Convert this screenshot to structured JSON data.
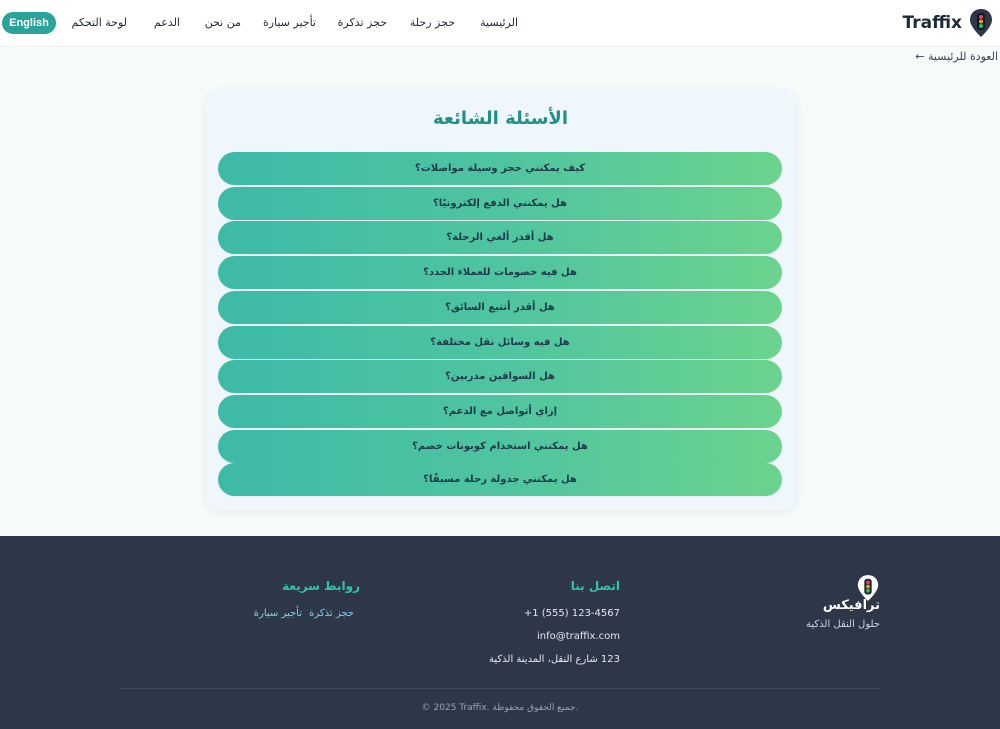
{
  "header": {
    "logo_text": "Traffix",
    "nav": [
      "الرئيسية",
      "حجز رحلة",
      "حجز تذكرة",
      "تأجير سيارة",
      "من نحن",
      "الدعم",
      "لوحة التحكم"
    ],
    "lang_button": "English"
  },
  "back_link": "← العودة للرئيسية",
  "faq": {
    "title": "الأسئلة الشائعة",
    "questions": [
      "كيف يمكنني حجز وسيلة مواصلات؟",
      "هل يمكنني الدفع إلكترونيًا؟",
      "هل أقدر ألغي الرحلة؟",
      "هل فيه خصومات للعملاء الجدد؟",
      "هل أقدر أتتبع السائق؟",
      "هل فيه وسائل نقل مختلفة؟",
      "هل السواقين مدربين؟",
      "إزاي أتواصل مع الدعم؟",
      "هل يمكنني استخدام كوبونات خصم؟",
      "هل يمكنني جدولة رحلة مسبقًا؟"
    ]
  },
  "footer": {
    "brand_name": "ترافيكس",
    "brand_tagline": "حلول النقل الذكية",
    "contact_title": "اتصل بنا",
    "phone": "+1 (555) 123-4567",
    "email": "info@traffix.com",
    "address": "123 شارع النقل، المدينة الذكية",
    "links_title": "روابط سريعة",
    "links": [
      "حجز تذكرة",
      "تأجير سيارة"
    ],
    "copyright": "© 2025 Traffix. جميع الحقوق محفوظة."
  },
  "colors": {
    "accent": "#2aa39a",
    "title": "#1f8f87",
    "gradient_start": "#3dbaa7",
    "gradient_end": "#6bd38e",
    "footer_bg": "#2e3748",
    "footer_heading": "#34c3a6"
  }
}
